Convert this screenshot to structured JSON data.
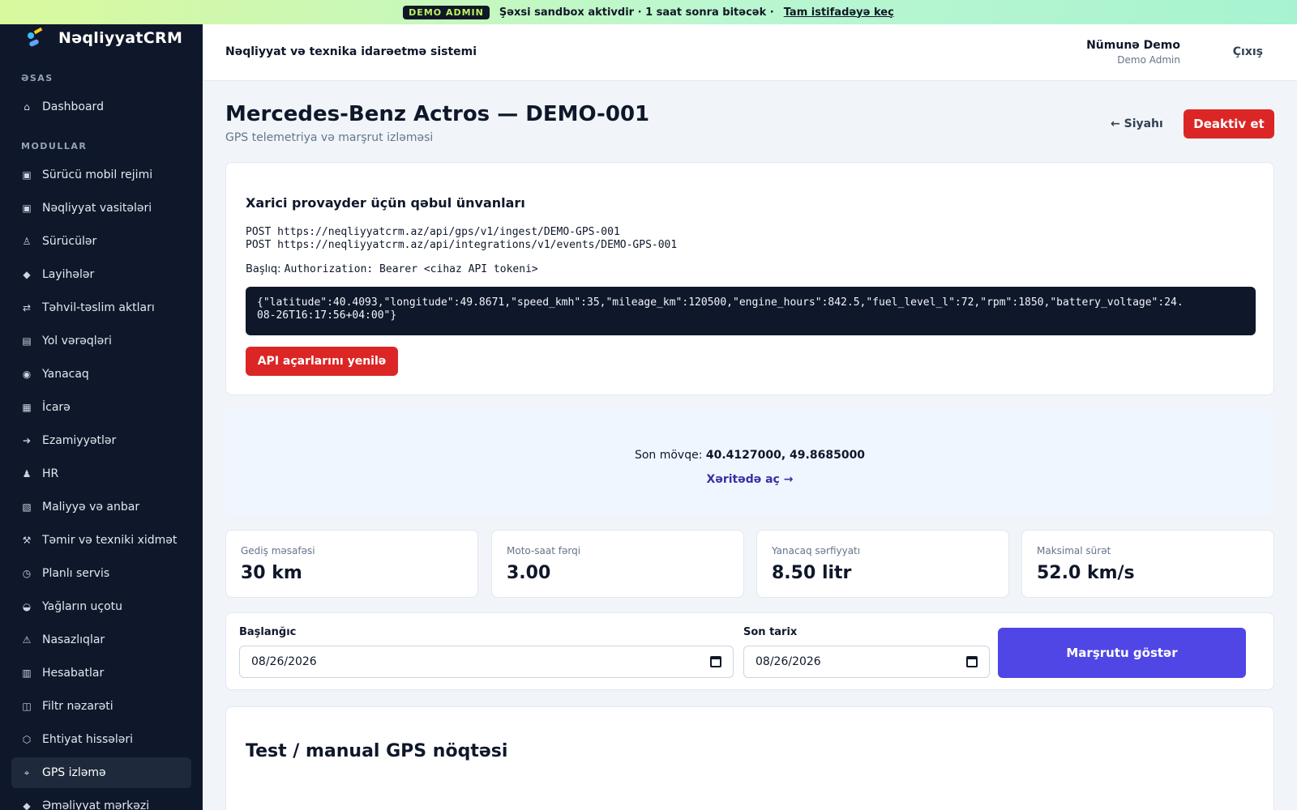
{
  "banner": {
    "badge": "DEMO ADMIN",
    "message": "Şəxsi sandbox aktivdir · 1 saat sonra bitəcək ·",
    "link": "Tam istifadəyə keç"
  },
  "brand": {
    "name": "NəqliyyatCRM"
  },
  "sidebar": {
    "section_main": "ƏSAS",
    "section_modules": "MODULLAR",
    "dashboard": {
      "label": "Dashboard",
      "icon": "home-icon"
    },
    "items": [
      {
        "label": "Sürücü mobil rejimi",
        "icon": "square-icon"
      },
      {
        "label": "Nəqliyyat vasitələri",
        "icon": "square-icon"
      },
      {
        "label": "Sürücülər",
        "icon": "person-icon"
      },
      {
        "label": "Layihələr",
        "icon": "diamond-icon"
      },
      {
        "label": "Təhvil-təslim aktları",
        "icon": "swap-icon"
      },
      {
        "label": "Yol vərəqləri",
        "icon": "list-icon"
      },
      {
        "label": "Yanacaq",
        "icon": "circle-icon"
      },
      {
        "label": "İcarə",
        "icon": "grid-icon"
      },
      {
        "label": "Ezamiyyətlər",
        "icon": "arrow-icon"
      },
      {
        "label": "HR",
        "icon": "user-icon"
      },
      {
        "label": "Maliyyə və anbar",
        "icon": "stack-icon"
      },
      {
        "label": "Təmir və texniki xidmət",
        "icon": "tools-icon"
      },
      {
        "label": "Planlı servis",
        "icon": "clock-icon"
      },
      {
        "label": "Yağların uçotu",
        "icon": "drop-icon"
      },
      {
        "label": "Nasazlıqlar",
        "icon": "warning-icon"
      },
      {
        "label": "Hesabatlar",
        "icon": "report-icon"
      },
      {
        "label": "Filtr nəzarəti",
        "icon": "filter-icon"
      },
      {
        "label": "Ehtiyat hissələri",
        "icon": "hexagon-icon"
      },
      {
        "label": "GPS izləmə",
        "icon": "gps-icon",
        "active": true
      },
      {
        "label": "Əməliyyat mərkəzi",
        "icon": "diamond-icon"
      }
    ]
  },
  "topbar": {
    "system_title": "Nəqliyyat və texnika idarəetmə sistemi",
    "user_name": "Nümunə Demo",
    "user_role": "Demo Admin",
    "logout": "Çıxış"
  },
  "page": {
    "title": "Mercedes-Benz Actros — DEMO-001",
    "subtitle": "GPS telemetriya və marşrut izləməsi",
    "back": "← Siyahı",
    "deactivate": "Deaktiv et"
  },
  "endpoints": {
    "title": "Xarici provayder üçün qəbul ünvanları",
    "url1": "POST https://neqliyyatcrm.az/api/gps/v1/ingest/DEMO-GPS-001",
    "url2": "POST https://neqliyyatcrm.az/api/integrations/v1/events/DEMO-GPS-001",
    "header_label": "Başlıq:",
    "header_value": "Authorization: Bearer <cihaz API tokeni>",
    "payload_line1": "{\"latitude\":40.4093,\"longitude\":49.8671,\"speed_kmh\":35,\"mileage_km\":120500,\"engine_hours\":842.5,\"fuel_level_l\":72,\"rpm\":1850,\"battery_voltage\":24.",
    "payload_line2": "08-26T16:17:56+04:00\"}",
    "regen_button": "API açarlarını yenilə"
  },
  "location": {
    "label": "Son mövqe:",
    "coords": "40.4127000, 49.8685000",
    "map_link": "Xəritədə aç →"
  },
  "stats": [
    {
      "label": "Gediş məsafəsi",
      "value": "30 km"
    },
    {
      "label": "Moto-saat fərqi",
      "value": "3.00"
    },
    {
      "label": "Yanacaq sərfiyyatı",
      "value": "8.50 litr"
    },
    {
      "label": "Maksimal sürət",
      "value": "52.0 km/s"
    }
  ],
  "filters": {
    "start_label": "Başlanğıc",
    "start_value": "08/26/2026",
    "end_label": "Son tarix",
    "end_value": "08/26/2026",
    "show_button": "Marşrutu göstər"
  },
  "manual": {
    "title": "Test / manual GPS nöqtəsi"
  }
}
